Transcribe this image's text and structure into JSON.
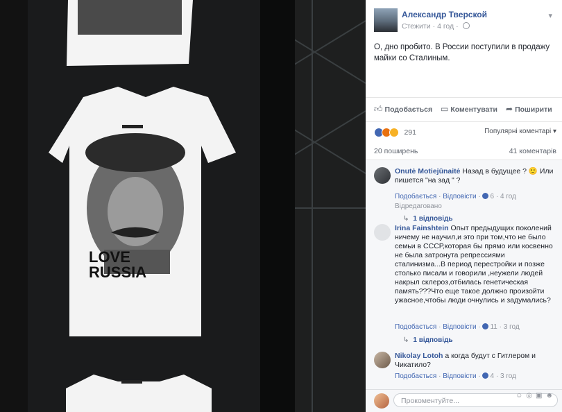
{
  "post": {
    "author": "Александр Тверской",
    "follow_label": "Стежити",
    "time": "4 год",
    "text": "О, дно пробито. В России поступили в продажу майки со Сталиным.",
    "shirt_text_line1": "LOVE",
    "shirt_text_line2": "RUSSIA"
  },
  "actions": {
    "like_label": "Подобається",
    "comment_label": "Коментувати",
    "share_label": "Поширити"
  },
  "reactions": {
    "count": "291",
    "sort_label": "Популярні коментарі",
    "shares": "20 поширень",
    "comments_count": "41 коментарів"
  },
  "comments": [
    {
      "name": "Onutė Motiejūnaitė",
      "text": "Назад в будущее ? 🙂 Или пишется \"на зад \" ?",
      "like": "Подобається",
      "reply": "Відповісти",
      "likes": "6",
      "time": "4 год",
      "edited": "Відредаговано",
      "replies": "1 відповідь"
    },
    {
      "name": "Irina Fainshtein",
      "text": "Опыт предыдущих поколений ничему не научил,и это при том,что не было семьи в СССР,которая бы прямо или косвенно не была затронута репрессиями сталинизма...В период перестройки и позже столько писали и говорили ,неужели людей накрыл склероз,отбилась генетическая память???Что еще такое должно произойти ужасное,чтобы люди очнулись и задумались?",
      "like": "Подобається",
      "reply": "Відповісти",
      "likes": "11",
      "time": "3 год",
      "replies": "1 відповідь"
    },
    {
      "name": "Nikolay Lotoh",
      "text": "а когда будут с Гитлером и Чикатило?",
      "like": "Подобається",
      "reply": "Відповісти",
      "likes": "4",
      "time": "3 год"
    }
  ],
  "composer": {
    "placeholder": "Прокоментуйте..."
  }
}
